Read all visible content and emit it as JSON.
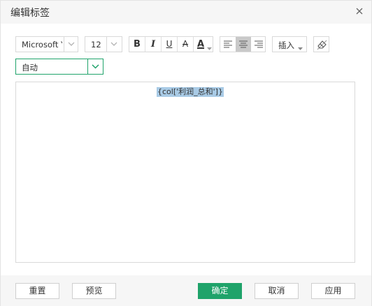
{
  "dialog": {
    "title": "编辑标签"
  },
  "toolbar": {
    "font_family": "Microsoft Ya",
    "font_size": "12",
    "bold_label": "B",
    "italic_label": "I",
    "underline_label": "U",
    "strikethrough_label": "A",
    "font_color_label": "A",
    "font_color_value": "#333333",
    "align_active": "center",
    "insert_label": "插入",
    "icons": [
      "bold-icon",
      "italic-icon",
      "underline-icon",
      "strikethrough-icon",
      "font-color-icon",
      "align-left-icon",
      "align-center-icon",
      "align-right-icon",
      "eraser-icon"
    ]
  },
  "mode_select": {
    "value": "自动"
  },
  "editor": {
    "content": "{col['利润_总和']}"
  },
  "footer": {
    "reset_label": "重置",
    "preview_label": "预览",
    "ok_label": "确定",
    "cancel_label": "取消",
    "apply_label": "应用"
  },
  "colors": {
    "accent": "#1fa36a",
    "selection": "#a9cbe6",
    "header_bg": "#f6f6f6"
  }
}
